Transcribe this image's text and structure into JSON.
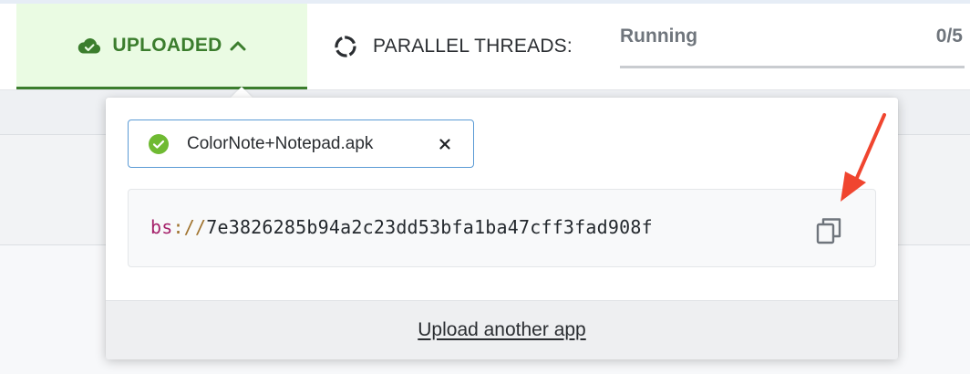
{
  "colors": {
    "accent_green": "#3b7d2d",
    "tab_background": "#eafbe3",
    "chip_border": "#5b9bd5",
    "success_icon": "#6fba32",
    "url_scheme": "#a5216a",
    "url_separator": "#a0732e",
    "annotation_arrow": "#f0452f"
  },
  "upload_tab": {
    "icon": "cloud-check-icon",
    "label": "UPLOADED",
    "chevron": "chevron-up-icon"
  },
  "parallel_threads": {
    "icon": "spinner-icon",
    "label": "PARALLEL THREADS:",
    "status": "Running",
    "count": "0/5",
    "progress_fraction": 0
  },
  "popover": {
    "file_chip": {
      "status_icon": "check-circle-icon",
      "file_name": "ColorNote+Notepad.apk",
      "remove_icon": "close-icon"
    },
    "app_url": {
      "scheme": "bs",
      "separator": "://",
      "id": "7e3826285b94a2c23dd53bfa1ba47cff3fad908f",
      "copy_icon": "copy-icon"
    },
    "footer": {
      "link_label": "Upload another app"
    }
  },
  "annotation": {
    "type": "arrow",
    "points_to": "copy-icon"
  }
}
